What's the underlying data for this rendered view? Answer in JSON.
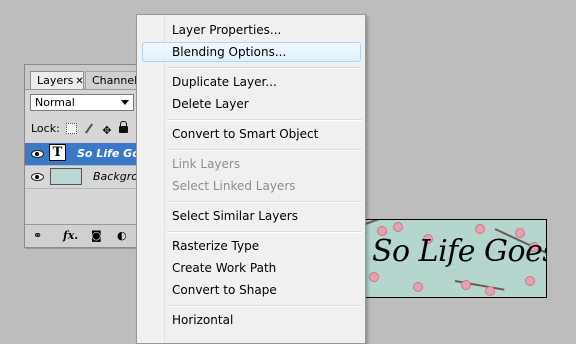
{
  "layers_panel": {
    "tabs": [
      {
        "label": "Layers",
        "close": "✕"
      },
      {
        "label": "Channels"
      }
    ],
    "blend_mode": "Normal",
    "lock_label": "Lock:",
    "layers": [
      {
        "name": "So Life Goes",
        "type": "text",
        "selected": true,
        "thumb_glyph": "T"
      },
      {
        "name": "Backgrou",
        "type": "image",
        "selected": false
      }
    ],
    "footer": {
      "fx": "fx."
    }
  },
  "context_menu": {
    "items": [
      {
        "label": "Layer Properties...",
        "enabled": true
      },
      {
        "label": "Blending Options...",
        "enabled": true,
        "highlighted": true
      },
      {
        "label": "Duplicate Layer...",
        "enabled": true
      },
      {
        "label": "Delete Layer",
        "enabled": true
      },
      {
        "label": "Convert to Smart Object",
        "enabled": true
      },
      {
        "label": "Link Layers",
        "enabled": false
      },
      {
        "label": "Select Linked Layers",
        "enabled": false
      },
      {
        "label": "Select Similar Layers",
        "enabled": true
      },
      {
        "label": "Rasterize Type",
        "enabled": true
      },
      {
        "label": "Create Work Path",
        "enabled": true
      },
      {
        "label": "Convert to Shape",
        "enabled": true
      },
      {
        "label": "Horizontal",
        "enabled": true
      }
    ]
  },
  "canvas": {
    "text": "So Life Goes",
    "background_color": "#b5d5cf",
    "blossom_color": "#e8a0ac"
  },
  "colors": {
    "selection": "#3a78c8",
    "menu_highlight_border": "#a8d8f3"
  }
}
